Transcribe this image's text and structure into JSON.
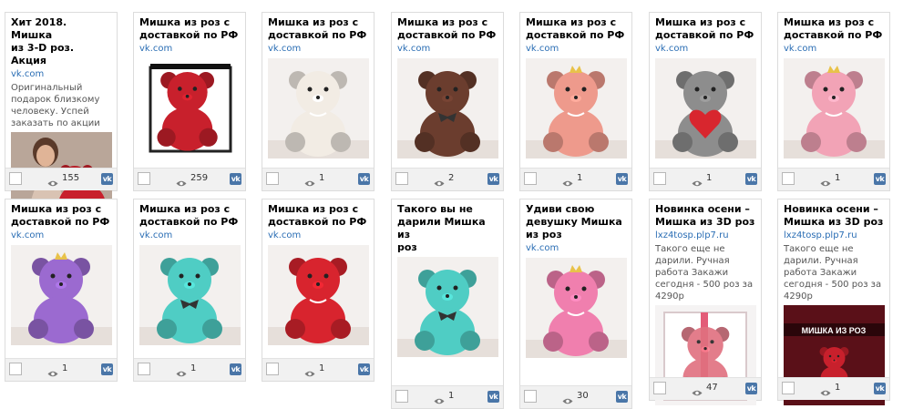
{
  "ads": [
    {
      "title": "Хит 2018. Мишка\nиз 3-D роз. Акция",
      "domain": "vk.com",
      "description": "Оригинальный\nподарок близкому\nчеловеку. Успей\nзаказать по акции",
      "views": "155",
      "image": "woman-with-red-rose-bear"
    },
    {
      "title": "Мишка из роз с\nдоставкой по РФ",
      "domain": "vk.com",
      "description": "",
      "views": "259",
      "image": "red-rose-bear-in-box",
      "color": "#c8202c"
    },
    {
      "title": "Мишка из роз с\nдоставкой по РФ",
      "domain": "vk.com",
      "description": "",
      "views": "1",
      "image": "white-rose-bear",
      "color": "#f2ece4"
    },
    {
      "title": "Мишка из роз с\nдоставкой по РФ",
      "domain": "vk.com",
      "description": "",
      "views": "2",
      "image": "brown-rose-bear",
      "color": "#6b3d2e"
    },
    {
      "title": "Мишка из роз с\nдоставкой по РФ",
      "domain": "vk.com",
      "description": "",
      "views": "1",
      "image": "peach-rose-bear",
      "color": "#ee9a8c"
    },
    {
      "title": "Мишка из роз с\nдоставкой по РФ",
      "domain": "vk.com",
      "description": "",
      "views": "1",
      "image": "grey-rose-bear-with-heart",
      "color": "#8d8d8d"
    },
    {
      "title": "Мишка из роз с\nдоставкой по РФ",
      "domain": "vk.com",
      "description": "",
      "views": "1",
      "image": "pink-rose-bear",
      "color": "#f2a3b6"
    },
    {
      "title": "Мишка из роз с\nдоставкой по РФ",
      "domain": "vk.com",
      "description": "",
      "views": "1",
      "image": "purple-rose-bear",
      "color": "#9b6ad0"
    },
    {
      "title": "Мишка из роз с\nдоставкой по РФ",
      "domain": "vk.com",
      "description": "",
      "views": "1",
      "image": "turquoise-rose-bear",
      "color": "#4fcdc4"
    },
    {
      "title": "Мишка из роз с\nдоставкой по РФ",
      "domain": "vk.com",
      "description": "",
      "views": "1",
      "image": "red-rose-bear",
      "color": "#d8242e"
    },
    {
      "title": "Такого вы не\nдарили Мишка из\nроз",
      "domain": "",
      "description": "",
      "views": "1",
      "image": "turquoise-rose-bear",
      "color": "#4fcdc4"
    },
    {
      "title": "Удиви свою\nдевушку Мишка\nиз роз",
      "domain": "vk.com",
      "description": "",
      "views": "30",
      "image": "pink-rose-bear",
      "color": "#f07fae"
    },
    {
      "title": "Новинка осени –\nМишка из 3D роз",
      "domain": "lxz4tosp.plp7.ru",
      "description": "Такого еще не\nдарили. Ручная\nработа Закажи\nсегодня - 500 роз за\n4290р",
      "views": "47",
      "image": "red-bear-in-gift-box",
      "color": "#d44a5c"
    },
    {
      "title": "Новинка осени –\nМишка из 3D роз",
      "domain": "lxz4tosp.plp7.ru",
      "description": "Такого еще не\nдарили. Ручная\nработа Закажи\nсегодня - 500 роз за\n4290р",
      "views": "1",
      "image": "banner-мишка-из-роз",
      "banner_text": "МИШКА ИЗ РОЗ",
      "color": "#c8202c"
    }
  ],
  "vk_badge": "vk"
}
